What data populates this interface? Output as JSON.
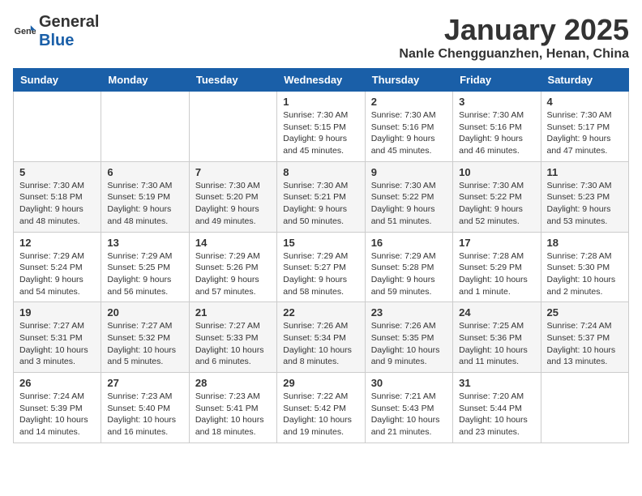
{
  "logo": {
    "general": "General",
    "blue": "Blue"
  },
  "header": {
    "title": "January 2025",
    "subtitle": "Nanle Chengguanzhen, Henan, China"
  },
  "weekdays": [
    "Sunday",
    "Monday",
    "Tuesday",
    "Wednesday",
    "Thursday",
    "Friday",
    "Saturday"
  ],
  "weeks": [
    [
      {
        "day": "",
        "info": ""
      },
      {
        "day": "",
        "info": ""
      },
      {
        "day": "",
        "info": ""
      },
      {
        "day": "1",
        "info": "Sunrise: 7:30 AM\nSunset: 5:15 PM\nDaylight: 9 hours\nand 45 minutes."
      },
      {
        "day": "2",
        "info": "Sunrise: 7:30 AM\nSunset: 5:16 PM\nDaylight: 9 hours\nand 45 minutes."
      },
      {
        "day": "3",
        "info": "Sunrise: 7:30 AM\nSunset: 5:16 PM\nDaylight: 9 hours\nand 46 minutes."
      },
      {
        "day": "4",
        "info": "Sunrise: 7:30 AM\nSunset: 5:17 PM\nDaylight: 9 hours\nand 47 minutes."
      }
    ],
    [
      {
        "day": "5",
        "info": "Sunrise: 7:30 AM\nSunset: 5:18 PM\nDaylight: 9 hours\nand 48 minutes."
      },
      {
        "day": "6",
        "info": "Sunrise: 7:30 AM\nSunset: 5:19 PM\nDaylight: 9 hours\nand 48 minutes."
      },
      {
        "day": "7",
        "info": "Sunrise: 7:30 AM\nSunset: 5:20 PM\nDaylight: 9 hours\nand 49 minutes."
      },
      {
        "day": "8",
        "info": "Sunrise: 7:30 AM\nSunset: 5:21 PM\nDaylight: 9 hours\nand 50 minutes."
      },
      {
        "day": "9",
        "info": "Sunrise: 7:30 AM\nSunset: 5:22 PM\nDaylight: 9 hours\nand 51 minutes."
      },
      {
        "day": "10",
        "info": "Sunrise: 7:30 AM\nSunset: 5:22 PM\nDaylight: 9 hours\nand 52 minutes."
      },
      {
        "day": "11",
        "info": "Sunrise: 7:30 AM\nSunset: 5:23 PM\nDaylight: 9 hours\nand 53 minutes."
      }
    ],
    [
      {
        "day": "12",
        "info": "Sunrise: 7:29 AM\nSunset: 5:24 PM\nDaylight: 9 hours\nand 54 minutes."
      },
      {
        "day": "13",
        "info": "Sunrise: 7:29 AM\nSunset: 5:25 PM\nDaylight: 9 hours\nand 56 minutes."
      },
      {
        "day": "14",
        "info": "Sunrise: 7:29 AM\nSunset: 5:26 PM\nDaylight: 9 hours\nand 57 minutes."
      },
      {
        "day": "15",
        "info": "Sunrise: 7:29 AM\nSunset: 5:27 PM\nDaylight: 9 hours\nand 58 minutes."
      },
      {
        "day": "16",
        "info": "Sunrise: 7:29 AM\nSunset: 5:28 PM\nDaylight: 9 hours\nand 59 minutes."
      },
      {
        "day": "17",
        "info": "Sunrise: 7:28 AM\nSunset: 5:29 PM\nDaylight: 10 hours\nand 1 minute."
      },
      {
        "day": "18",
        "info": "Sunrise: 7:28 AM\nSunset: 5:30 PM\nDaylight: 10 hours\nand 2 minutes."
      }
    ],
    [
      {
        "day": "19",
        "info": "Sunrise: 7:27 AM\nSunset: 5:31 PM\nDaylight: 10 hours\nand 3 minutes."
      },
      {
        "day": "20",
        "info": "Sunrise: 7:27 AM\nSunset: 5:32 PM\nDaylight: 10 hours\nand 5 minutes."
      },
      {
        "day": "21",
        "info": "Sunrise: 7:27 AM\nSunset: 5:33 PM\nDaylight: 10 hours\nand 6 minutes."
      },
      {
        "day": "22",
        "info": "Sunrise: 7:26 AM\nSunset: 5:34 PM\nDaylight: 10 hours\nand 8 minutes."
      },
      {
        "day": "23",
        "info": "Sunrise: 7:26 AM\nSunset: 5:35 PM\nDaylight: 10 hours\nand 9 minutes."
      },
      {
        "day": "24",
        "info": "Sunrise: 7:25 AM\nSunset: 5:36 PM\nDaylight: 10 hours\nand 11 minutes."
      },
      {
        "day": "25",
        "info": "Sunrise: 7:24 AM\nSunset: 5:37 PM\nDaylight: 10 hours\nand 13 minutes."
      }
    ],
    [
      {
        "day": "26",
        "info": "Sunrise: 7:24 AM\nSunset: 5:39 PM\nDaylight: 10 hours\nand 14 minutes."
      },
      {
        "day": "27",
        "info": "Sunrise: 7:23 AM\nSunset: 5:40 PM\nDaylight: 10 hours\nand 16 minutes."
      },
      {
        "day": "28",
        "info": "Sunrise: 7:23 AM\nSunset: 5:41 PM\nDaylight: 10 hours\nand 18 minutes."
      },
      {
        "day": "29",
        "info": "Sunrise: 7:22 AM\nSunset: 5:42 PM\nDaylight: 10 hours\nand 19 minutes."
      },
      {
        "day": "30",
        "info": "Sunrise: 7:21 AM\nSunset: 5:43 PM\nDaylight: 10 hours\nand 21 minutes."
      },
      {
        "day": "31",
        "info": "Sunrise: 7:20 AM\nSunset: 5:44 PM\nDaylight: 10 hours\nand 23 minutes."
      },
      {
        "day": "",
        "info": ""
      }
    ]
  ]
}
